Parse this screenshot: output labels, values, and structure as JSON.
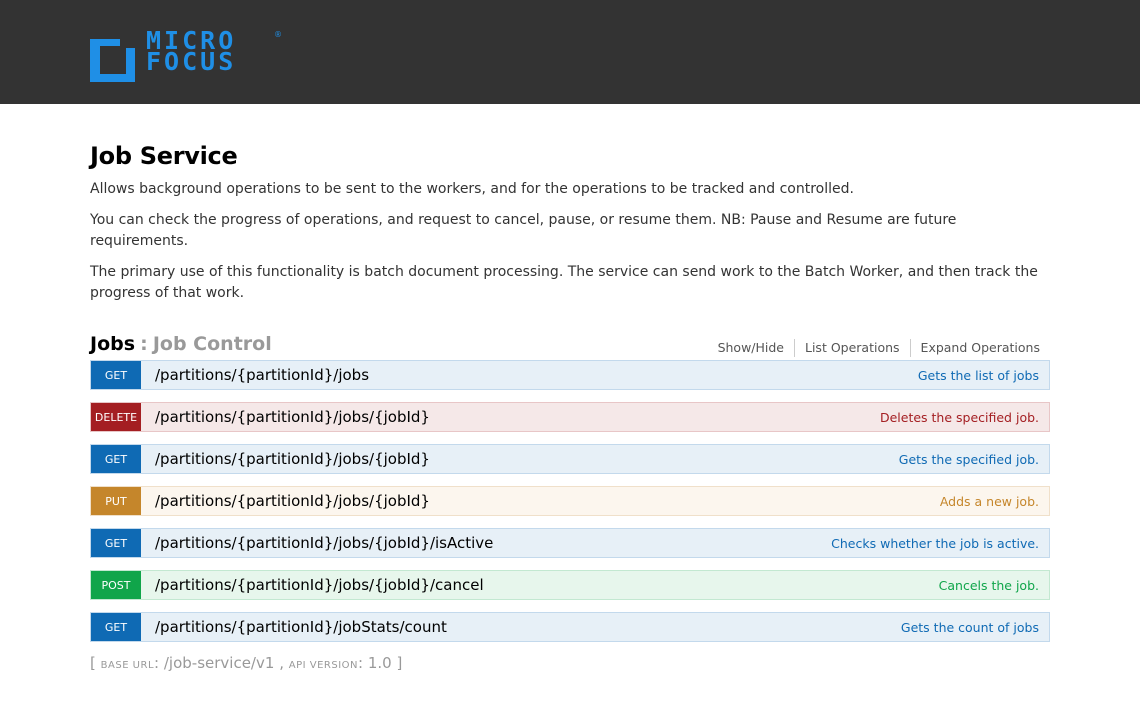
{
  "header": {
    "logo_line1": "MICRO",
    "logo_line2": "FOCUS",
    "logo_reg": "®"
  },
  "page": {
    "title": "Job Service",
    "description": [
      "Allows background operations to be sent to the workers, and for the operations to be tracked and controlled.",
      "You can check the progress of operations, and request to cancel, pause, or resume them. NB: Pause and Resume are future requirements.",
      "The primary use of this functionality is batch document processing. The service can send work to the Batch Worker, and then track the progress of that work."
    ]
  },
  "resource": {
    "name": "Jobs",
    "separator": ":",
    "description": "Job Control",
    "links": [
      "Show/Hide",
      "List Operations",
      "Expand Operations"
    ]
  },
  "operations": [
    {
      "method": "GET",
      "path": "/partitions/{partitionId}/jobs",
      "summary": "Gets the list of jobs"
    },
    {
      "method": "DELETE",
      "path": "/partitions/{partitionId}/jobs/{jobId}",
      "summary": "Deletes the specified job."
    },
    {
      "method": "GET",
      "path": "/partitions/{partitionId}/jobs/{jobId}",
      "summary": "Gets the specified job."
    },
    {
      "method": "PUT",
      "path": "/partitions/{partitionId}/jobs/{jobId}",
      "summary": "Adds a new job."
    },
    {
      "method": "GET",
      "path": "/partitions/{partitionId}/jobs/{jobId}/isActive",
      "summary": "Checks whether the job is active."
    },
    {
      "method": "POST",
      "path": "/partitions/{partitionId}/jobs/{jobId}/cancel",
      "summary": "Cancels the job."
    },
    {
      "method": "GET",
      "path": "/partitions/{partitionId}/jobStats/count",
      "summary": "Gets the count of jobs"
    }
  ],
  "footer": {
    "open_bracket": "[",
    "base_url_label": "BASE URL",
    "base_url_value": "/job-service/v1",
    "comma": ",",
    "api_version_label": "API VERSION",
    "api_version_value": "1.0",
    "close_bracket": "]"
  },
  "colors": {
    "topbar": "#333333",
    "brand": "#1f8fe6",
    "get": "#0f6ab4",
    "delete": "#a41e22",
    "put": "#c5862b",
    "post": "#10a54a"
  }
}
